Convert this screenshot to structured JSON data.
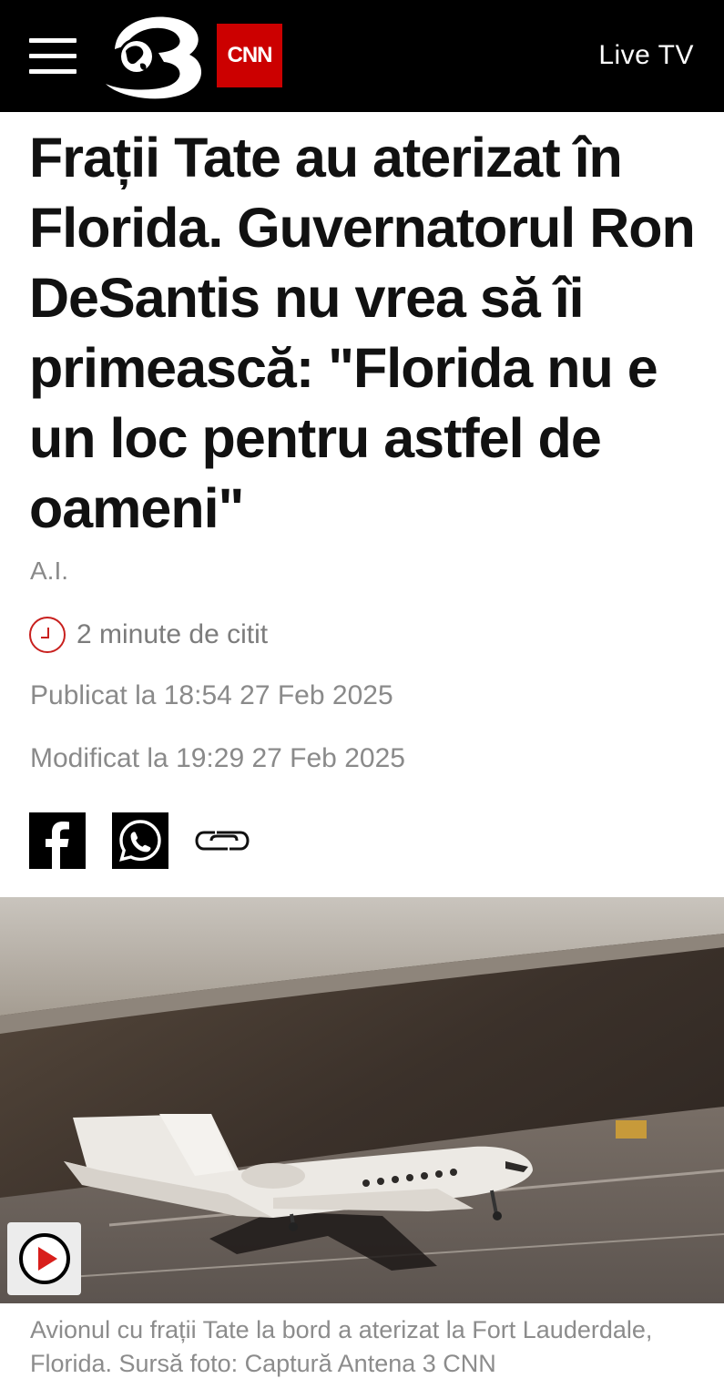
{
  "header": {
    "menu_icon": "hamburger-icon",
    "logo_icon": "antena3-logo",
    "cnn_label": "CNN",
    "live_tv_label": "Live TV"
  },
  "article": {
    "headline": "Frații Tate au aterizat în Florida. Guvernatorul Ron DeSantis nu vrea să îi primească: \"Florida nu e un loc pentru astfel de oameni\"",
    "author": "A.I.",
    "read_time": "2 minute de citit",
    "published": "Publicat la 18:54 27 Feb 2025",
    "modified": "Modificat la 19:29 27 Feb 2025"
  },
  "share": {
    "facebook_icon": "facebook-icon",
    "whatsapp_icon": "whatsapp-icon",
    "copy_link_icon": "link-icon"
  },
  "media": {
    "play_icon": "play-icon",
    "caption": "Avionul cu frații Tate la bord a aterizat la Fort Lauderdale, Florida. Sursă foto: Captură Antena 3 CNN"
  },
  "colors": {
    "header_bg": "#000000",
    "cnn_red": "#cc0000",
    "accent_red": "#c8201e",
    "meta_gray": "#8a8a8a"
  }
}
